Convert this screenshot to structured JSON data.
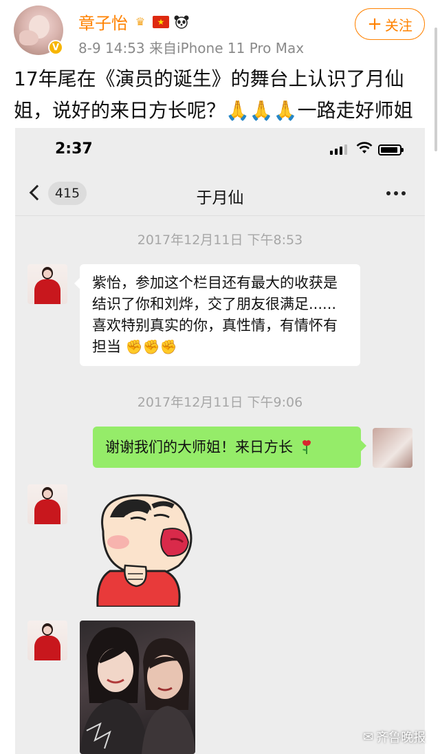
{
  "post": {
    "username": "章子怡",
    "badges": [
      "crown-icon",
      "china-flag-icon",
      "panda-icon"
    ],
    "meta": "8-9 14:53  来自iPhone 11 Pro Max",
    "follow_label": "关注",
    "text": "17年尾在《演员的诞生》的舞台上认识了月仙姐，说好的来日方长呢？🙏🙏🙏一路走好师姐"
  },
  "screenshot": {
    "status_time": "2:37",
    "unread_count": "415",
    "chat_title": "于月仙",
    "messages": [
      {
        "timestamp": "2017年12月11日 下午8:53"
      },
      {
        "sender": "contact",
        "text": "紫怡，参加这个栏目还有最大的收获是结识了你和刘烨，交了朋友很满足......喜欢特别真实的你，真性情，有情怀有担当",
        "trailing_icons": [
          "fist-icon",
          "fist-icon",
          "fist-icon"
        ]
      },
      {
        "timestamp": "2017年12月11日 下午9:06"
      },
      {
        "sender": "me",
        "text": "谢谢我们的大师姐！来日方长",
        "trailing_icon": "rose-icon"
      },
      {
        "sender": "contact",
        "type": "sticker",
        "sticker": "crayon-shin-chan-kiss-sticker"
      },
      {
        "sender": "contact",
        "type": "photo"
      }
    ]
  },
  "watermark": "齐鲁晚报",
  "colors": {
    "weibo_orange": "#ff8200",
    "chat_bg": "#ededed",
    "my_bubble": "#95ec69",
    "timestamp_gray": "#a6a6a6"
  }
}
